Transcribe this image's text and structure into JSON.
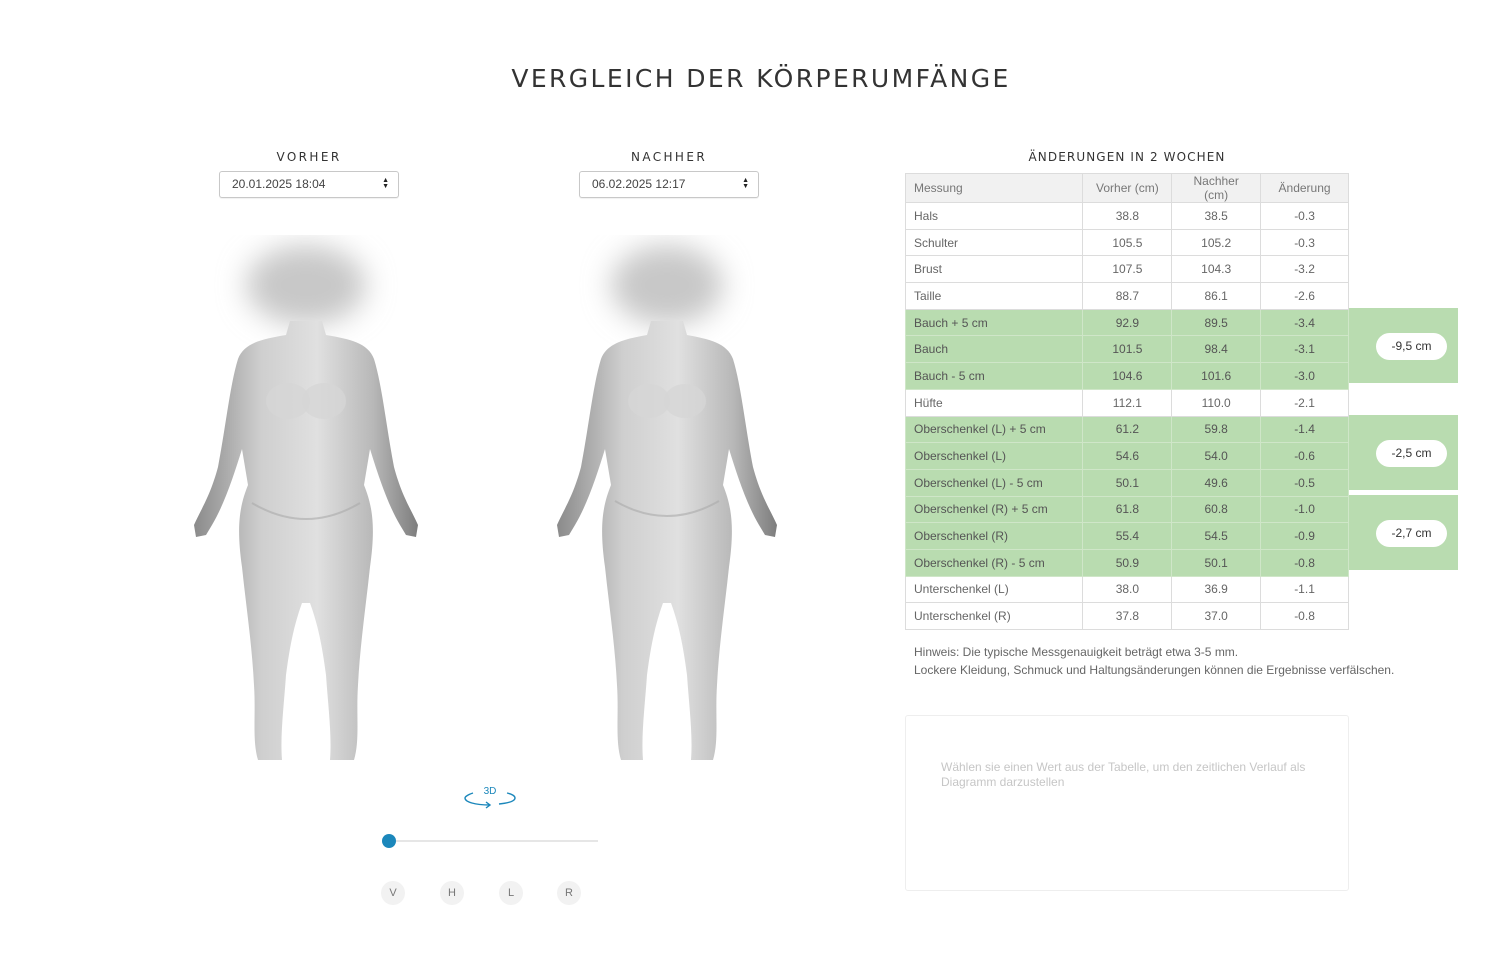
{
  "page": {
    "title": "VERGLEICH DER KÖRPERUMFÄNGE"
  },
  "before": {
    "label": "VORHER",
    "selected_date": "20.01.2025 18:04"
  },
  "after": {
    "label": "NACHHER",
    "selected_date": "06.02.2025 12:17"
  },
  "viewer": {
    "rotate_label": "3D",
    "rotation_slider_value": 0,
    "view_buttons": [
      "V",
      "H",
      "L",
      "R"
    ]
  },
  "table": {
    "title": "ÄNDERUNGEN IN 2 WOCHEN",
    "headers": [
      "Messung",
      "Vorher (cm)",
      "Nachher (cm)",
      "Änderung"
    ],
    "rows": [
      [
        "Hals",
        "38.8",
        "38.5",
        "-0.3"
      ],
      [
        "Schulter",
        "105.5",
        "105.2",
        "-0.3"
      ],
      [
        "Brust",
        "107.5",
        "104.3",
        "-3.2"
      ],
      [
        "Taille",
        "88.7",
        "86.1",
        "-2.6"
      ],
      [
        "Bauch + 5 cm",
        "92.9",
        "89.5",
        "-3.4"
      ],
      [
        "Bauch",
        "101.5",
        "98.4",
        "-3.1"
      ],
      [
        "Bauch - 5 cm",
        "104.6",
        "101.6",
        "-3.0"
      ],
      [
        "Hüfte",
        "112.1",
        "110.0",
        "-2.1"
      ],
      [
        "Oberschenkel (L) + 5 cm",
        "61.2",
        "59.8",
        "-1.4"
      ],
      [
        "Oberschenkel (L)",
        "54.6",
        "54.0",
        "-0.6"
      ],
      [
        "Oberschenkel (L) - 5 cm",
        "50.1",
        "49.6",
        "-0.5"
      ],
      [
        "Oberschenkel (R) + 5 cm",
        "61.8",
        "60.8",
        "-1.0"
      ],
      [
        "Oberschenkel (R)",
        "55.4",
        "54.5",
        "-0.9"
      ],
      [
        "Oberschenkel (R) - 5 cm",
        "50.9",
        "50.1",
        "-0.8"
      ],
      [
        "Unterschenkel (L)",
        "38.0",
        "36.9",
        "-1.1"
      ],
      [
        "Unterschenkel (R)",
        "37.8",
        "37.0",
        "-0.8"
      ]
    ],
    "highlight_groups": [
      {
        "total": "-9,5 cm",
        "rows": [
          4,
          5,
          6
        ]
      },
      {
        "total": "-2,5 cm",
        "rows": [
          8,
          9,
          10
        ]
      },
      {
        "total": "-2,7 cm",
        "rows": [
          11,
          12,
          13
        ]
      }
    ],
    "highlight_color": "#b9dcb0"
  },
  "note": {
    "line1": "Hinweis: Die typische Messgenauigkeit beträgt etwa 3-5 mm.",
    "line2": "Lockere Kleidung, Schmuck und Haltungsänderungen können die Ergebnisse verfälschen."
  },
  "chart_box": {
    "placeholder": "Wählen sie einen Wert aus der Tabelle, um den zeitlichen Verlauf als Diagramm darzustellen"
  },
  "colors": {
    "accent": "#1b87bb",
    "highlight": "#b9dcb0"
  }
}
